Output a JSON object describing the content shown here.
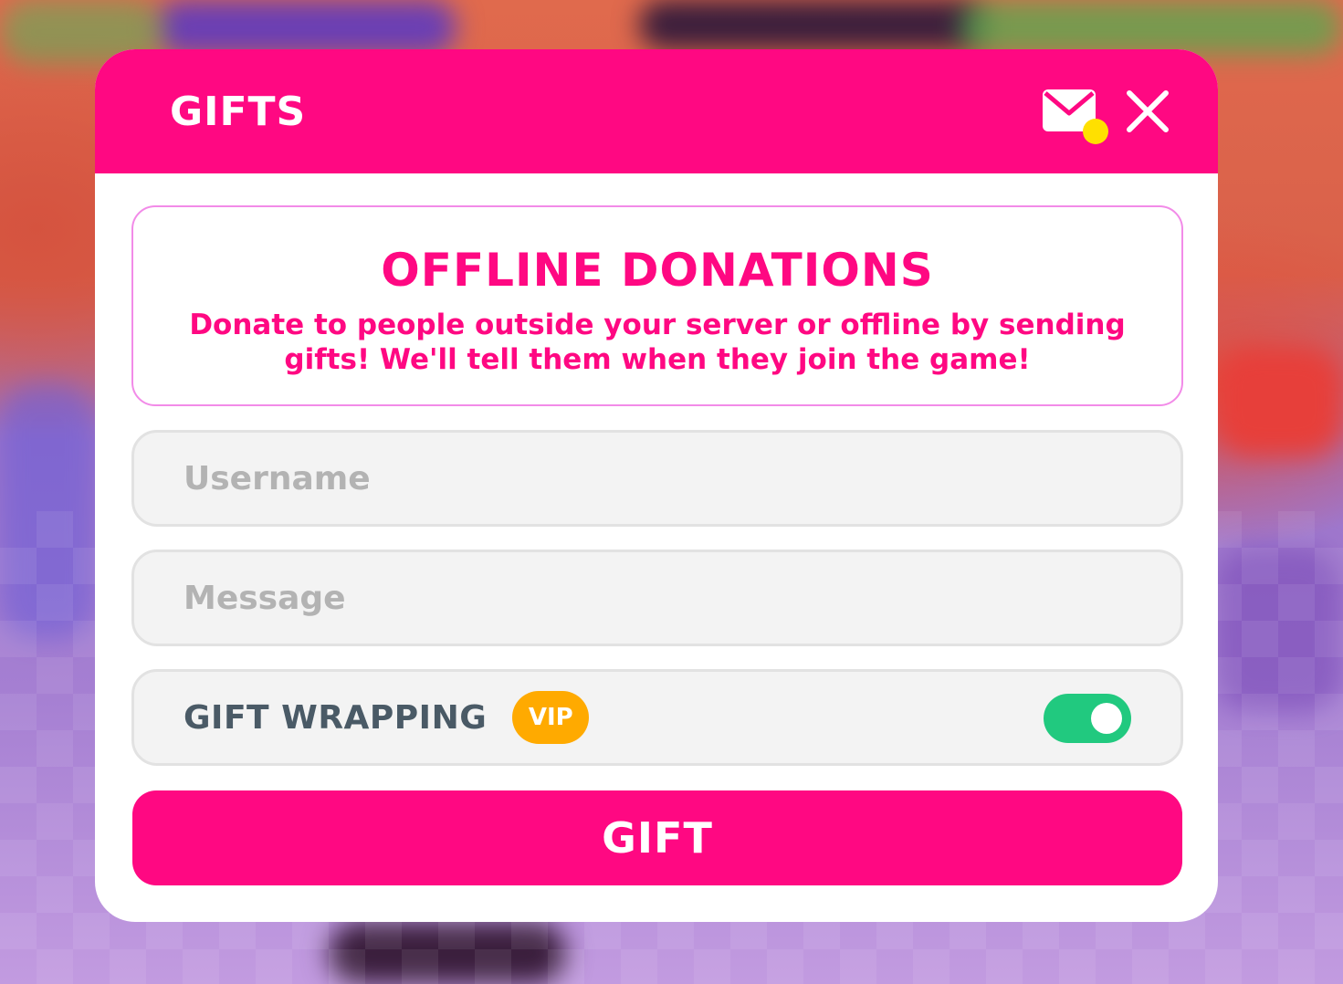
{
  "header": {
    "title": "GIFTS",
    "mail_icon": "mail-icon",
    "notification_color": "#ffe000",
    "close_icon": "close-icon"
  },
  "info": {
    "title": "OFFLINE DONATIONS",
    "text": "Donate to people outside your server or offline by sending gifts! We'll tell them when they join the game!"
  },
  "form": {
    "username": {
      "value": "",
      "placeholder": "Username"
    },
    "message": {
      "value": "",
      "placeholder": "Message"
    },
    "gift_wrapping": {
      "label": "GIFT WRAPPING",
      "badge": "VIP",
      "enabled": true
    }
  },
  "submit_label": "GIFT",
  "colors": {
    "accent": "#ff0882",
    "vip": "#ffaa00",
    "toggle_on": "#21c97f",
    "info_border": "#f28be8"
  }
}
